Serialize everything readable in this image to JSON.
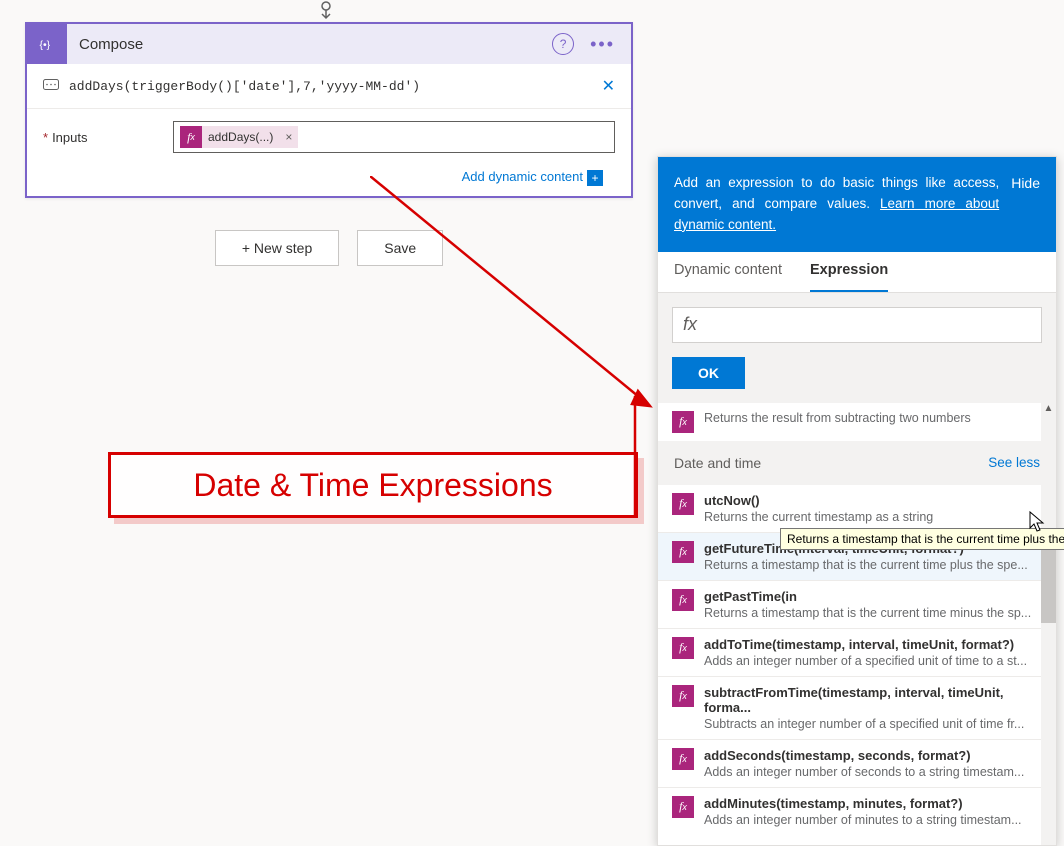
{
  "action": {
    "title": "Compose",
    "icon": "compose-icon",
    "expression_preview": "addDays(triggerBody()['date'],7,'yyyy-MM-dd')",
    "inputs_label": "Inputs",
    "token_label": "addDays(...)",
    "add_dynamic": "Add dynamic content"
  },
  "buttons": {
    "new_step": "+ New step",
    "save": "Save"
  },
  "annotation": "Date & Time Expressions",
  "pane": {
    "banner": "Add an expression to do basic things like access, convert, and compare values.",
    "learn_more": "Learn more about dynamic content.",
    "hide": "Hide",
    "tabs": {
      "dynamic": "Dynamic content",
      "expression": "Expression"
    },
    "fx_placeholder": "fx",
    "ok": "OK",
    "trailing_prev": "Returns the result from subtracting two numbers",
    "section": {
      "title": "Date and time",
      "seeless": "See less"
    },
    "items": [
      {
        "title": "utcNow()",
        "desc": "Returns the current timestamp as a string"
      },
      {
        "title": "getFutureTime(interval, timeUnit, format?)",
        "desc": "Returns a timestamp that is the current time plus the spe..."
      },
      {
        "title": "getPastTime(in",
        "desc": "Returns a timestamp that is the current time minus the sp..."
      },
      {
        "title": "addToTime(timestamp, interval, timeUnit, format?)",
        "desc": "Adds an integer number of a specified unit of time to a st..."
      },
      {
        "title": "subtractFromTime(timestamp, interval, timeUnit, forma...",
        "desc": "Subtracts an integer number of a specified unit of time fr..."
      },
      {
        "title": "addSeconds(timestamp, seconds, format?)",
        "desc": "Adds an integer number of seconds to a string timestam..."
      },
      {
        "title": "addMinutes(timestamp, minutes, format?)",
        "desc": "Adds an integer number of minutes to a string timestam..."
      }
    ],
    "tooltip": "Returns a timestamp that is the current time plus the"
  }
}
